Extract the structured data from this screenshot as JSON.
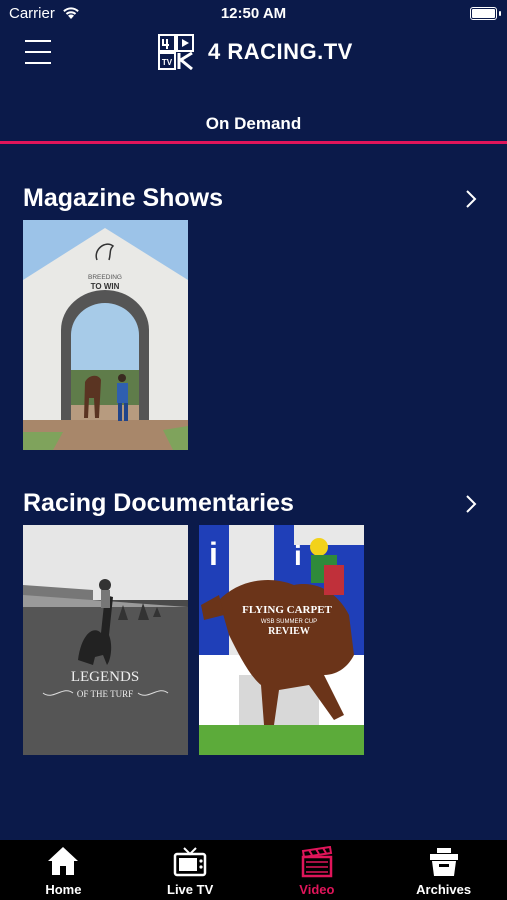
{
  "status_bar": {
    "carrier": "Carrier",
    "time": "12:50 AM"
  },
  "header": {
    "logo_text": "4 RACING.TV",
    "logo_badge": "TV"
  },
  "tab": {
    "label": "On Demand",
    "accent_color": "#e0155a"
  },
  "sections": [
    {
      "title": "Magazine Shows",
      "items": [
        {
          "title_line1": "BREEDING",
          "title_line2": "TO WIN"
        }
      ]
    },
    {
      "title": "Racing Documentaries",
      "items": [
        {
          "title_line1": "LEGENDS",
          "title_line2": "OF THE TURF"
        },
        {
          "title_line1": "FLYING CARPET",
          "title_line2": "WSB SUMMER CUP",
          "title_line3": "REVIEW"
        }
      ]
    }
  ],
  "bottom_nav": {
    "active_color": "#e0155a",
    "items": [
      {
        "label": "Home",
        "icon": "home-icon"
      },
      {
        "label": "Live TV",
        "icon": "tv-icon"
      },
      {
        "label": "Video",
        "icon": "clapperboard-icon",
        "active": true
      },
      {
        "label": "Archives",
        "icon": "archive-box-icon"
      }
    ]
  }
}
